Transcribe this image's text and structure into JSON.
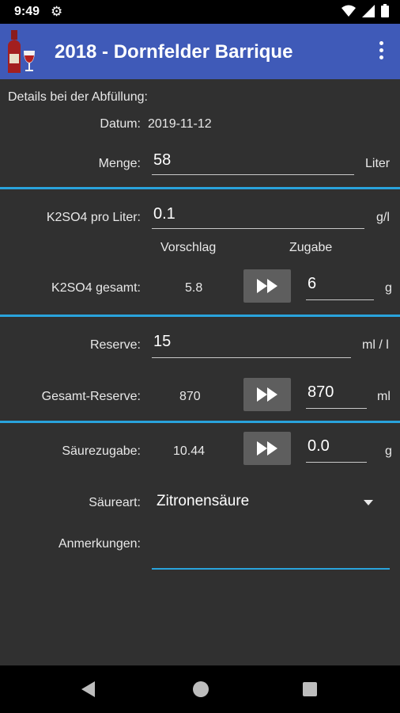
{
  "status_bar": {
    "time": "9:49",
    "icons": [
      "gear-icon",
      "wifi-icon",
      "signal-icon",
      "battery-icon"
    ]
  },
  "app_bar": {
    "title": "2018 - Dornfelder Barrique",
    "logo_icon": "wine-bottle-glass-icon",
    "menu_icon": "overflow-menu-icon",
    "color": "#3f5ab8"
  },
  "form": {
    "section_heading": "Details bei der Abfüllung:",
    "datum_label": "Datum:",
    "datum_value": "2019-11-12",
    "menge_label": "Menge:",
    "menge_value": "58",
    "menge_unit": "Liter",
    "k2so4_per_liter_label": "K2SO4 pro Liter:",
    "k2so4_per_liter_value": "0.1",
    "k2so4_per_liter_unit": "g/l",
    "col_vorschlag": "Vorschlag",
    "col_zugabe": "Zugabe",
    "k2so4_gesamt_label": "K2SO4 gesamt:",
    "k2so4_gesamt_suggestion": "5.8",
    "k2so4_gesamt_value": "6",
    "k2so4_gesamt_unit": "g",
    "reserve_label": "Reserve:",
    "reserve_value": "15",
    "reserve_unit": "ml / l",
    "gesamt_reserve_label": "Gesamt-Reserve:",
    "gesamt_reserve_suggestion": "870",
    "gesamt_reserve_value": "870",
    "gesamt_reserve_unit": "ml",
    "saeurezugabe_label": "Säurezugabe:",
    "saeurezugabe_suggestion": "10.44",
    "saeurezugabe_value": "0.0",
    "saeurezugabe_unit": "g",
    "saeureart_label": "Säureart:",
    "saeureart_value": "Zitronensäure",
    "anmerkungen_label": "Anmerkungen:",
    "anmerkungen_value": ""
  },
  "colors": {
    "background": "#303030",
    "accent": "#29a3dc",
    "button": "#5e5e5e"
  },
  "nav_bar": {
    "icons": [
      "back-icon",
      "home-icon",
      "recents-icon"
    ]
  }
}
